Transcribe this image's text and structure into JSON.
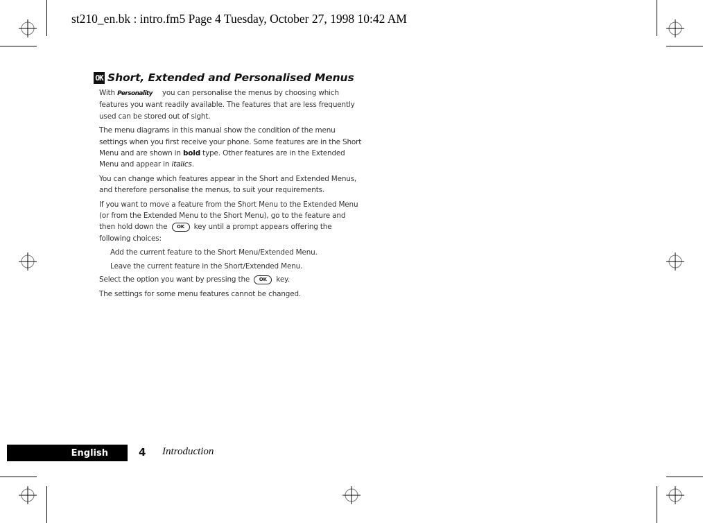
{
  "header": {
    "stamp": "st210_en.bk : intro.fm5  Page 4  Tuesday, October 27, 1998  10:42 AM"
  },
  "section": {
    "icon": "ok-key-icon",
    "icon_label": "OK",
    "title": "Short, Extended and Personalised Menus"
  },
  "paragraphs": {
    "p1_pre": "With ",
    "p1_brand": "Personality",
    "p1_post": "you can personalise the menus by choosing which features you want readily available. The features that are less frequently used can be stored out of sight.",
    "p2_pre": "The menu diagrams in this manual show the condition of the menu settings when you first receive your phone. Some features are in the Short Menu and are shown in ",
    "p2_bold": "bold",
    "p2_mid": " type. Other features are in the Extended Menu and appear in ",
    "p2_italic": "italics",
    "p2_end": ".",
    "p3": "You can change which features appear in the Short and Extended Menus, and therefore personalise the menus, to suit your requirements.",
    "p4_pre": "If you want to move a feature from the Short Menu to the Extended Menu (or from the Extended Menu to the Short Menu), go to the feature and then hold down the ",
    "p4_post": " key until a prompt appears offering the following choices:",
    "choices": [
      "Add the current feature to the Short Menu/Extended Menu.",
      "Leave the current feature in the Short/Extended Menu."
    ],
    "p5_pre": "Select the option you want by pressing the ",
    "p5_post": " key.",
    "p6": "The settings for some menu features cannot be changed.",
    "ok_key_label": "OK"
  },
  "footer": {
    "language": "English",
    "page_number": "4",
    "section": "Introduction"
  }
}
